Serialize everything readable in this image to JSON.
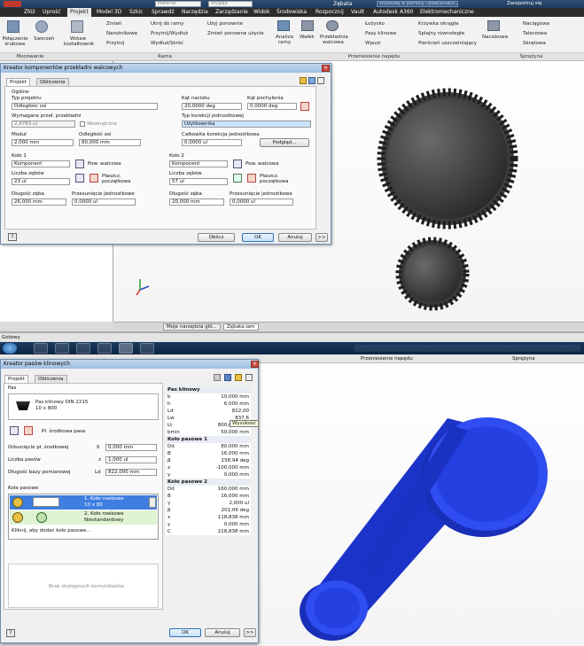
{
  "top": {
    "title_center": "Zębata",
    "title_search": "Wyszukaj w pomocy i poleceniach...",
    "title_signin": "Zarejestruj się",
    "title_material": "Materiał",
    "title_appearance": "Wygląd",
    "menu": [
      "Złóż",
      "Uprość",
      "Projekt",
      "Model 3D",
      "Szkic",
      "Sprawdź",
      "Narzędzia",
      "Zarządzanie",
      "Widok",
      "Środowiska",
      "Rozpocznij",
      "Vault",
      "Autodesk A360",
      "Elektromechaniczne"
    ],
    "ribbon": {
      "polaczenie": "Połączenie śrubowe",
      "sworzen": "Sworzeń",
      "wstaw": "Wstaw kształtownik",
      "zmien": "Zmień",
      "narozniki": "Narożnikowe",
      "przytnij": "Przytnij",
      "utnij": "Utnij do ramy",
      "przytnij_wydluz": "Przytnij/Wydłuż",
      "wydluz_skroc": "Wydłuż/Skróć",
      "uzyj_ponownie": "Użyj ponownie",
      "zmien_ponowne": "Zmień ponowne użycie",
      "analiza": "Analiza ramy",
      "walek": "Wałek",
      "przekladnia": "Przekładnia walcowa",
      "lozysko": "Łożysko",
      "pasy": "Pasy klinowe",
      "wpust": "Wpust",
      "krzywka": "Krzywka okrągła",
      "splajny": "Splajny równoległe",
      "pierscien": "Pierścień uszczelniający",
      "naciskowa": "Naciskowa",
      "naciagowa": "Naciągowa",
      "talerzowa": "Talerzowa",
      "skretowa": "Skrętowa",
      "grp_mocowanie": "Mocowanie",
      "grp_rama": "Rama",
      "grp_przeniesienie": "Przeniesienie napędu",
      "grp_sprezyna": "Sprężyna"
    },
    "dialog": {
      "title": "Kreator komponentów przekładni walcowych",
      "tab_projekt": "Projekt",
      "tab_obliczenia": "Obliczenia",
      "ogolne": "Ogólne",
      "typ_projektu": "Typ projektu",
      "typ_projektu_val": "Odległość osi",
      "wymagane": "Wymagane przeł. przekładni",
      "wymagane_val": "2,4783 ul",
      "wewnetrzne": "Wewnętrzne",
      "modul": "Moduł",
      "modul_val": "2,000 mm",
      "odl_osi": "Odległość osi",
      "odl_osi_val": "80,000 mm",
      "kat_nacisku": "Kąt nacisku",
      "kat_nacisku_val": "20,0000 deg",
      "kat_pochylenia": "Kąt pochylenia",
      "kat_pochylenia_val": "0,0000 deg",
      "typ_korekcji": "Typ korekcji jednostkowej",
      "typ_korekcji_val": "Użytkownika",
      "calkowita": "Całkowita korekcja jednostkowa",
      "calkowita_val": "0,0000 ul",
      "podglad": "Podgląd...",
      "kolo1": "Koło 1",
      "kolo2": "Koło 2",
      "komponent": "Komponent",
      "pow_walcowa": "Pow. walcowa",
      "liczba_zebow": "Liczba zębów",
      "z1": "23 ul",
      "z2": "57 ul",
      "plaszcz": "Płaszcz. początkowa",
      "dlugosc_zeba": "Długość zęba",
      "przesuniecie": "Przesunięcie jednostkowe",
      "b1": "26,000 mm",
      "b2": "20,000 mm",
      "x1": "0,0000 ul",
      "x2": "0,0000 ul",
      "oblicz": "Oblicz",
      "ok": "OK",
      "anuluj": "Anuluj",
      "more": ">>"
    },
    "browser_tabs": [
      "Moje narzędzia głó...",
      "Zębata.iam"
    ],
    "status": "Gotowy"
  },
  "bottom": {
    "ribbon_grp1": "Przeniesienie napędu",
    "ribbon_grp2": "Sprężyna",
    "dialog": {
      "title": "Kreator pasów klinowych",
      "tab_projekt": "Projekt",
      "tab_obliczenia": "Obliczenia",
      "pas": "Pas",
      "pas_name": "Pas klinowy DIN 2215",
      "pas_size": "10 x 800",
      "pl_srodkowa": "Pł. środkowa pasa",
      "odsuniecie": "Odsunięcie pł. środkowej",
      "odsuniecie_sym": "δ",
      "odsuniecie_val": "0,000 mm",
      "liczba_pasow": "Liczba pasów",
      "liczba_pasow_sym": "z",
      "liczba_pasow_val": "1,000 ul",
      "dlugosc_bazy": "Długość bazy pomiarowej",
      "dlugosc_bazy_sym": "Ld",
      "dlugosc_bazy_val": "822,000 mm",
      "kola": "Koła pasowe",
      "kolo1_a": "1. Koło rowkowe",
      "kolo1_b": "10 x 80",
      "kolo2_a": "2. Koło rowkowe",
      "kolo2_b": "Niestandardowy",
      "add": "Kliknij, aby dodać koło pasowe...",
      "brak": "Brak dostępnych komunikatów.",
      "ok": "OK",
      "anuluj": "Anuluj",
      "more": ">>",
      "tooltip": "Wysokość"
    },
    "props": {
      "pas_klinowy": "Pas klinowy",
      "kolo_pasowe_1": "Koło pasowe 1",
      "kolo_pasowe_2": "Koło pasowe 2",
      "rows1": [
        [
          "b",
          "10,000 mm"
        ],
        [
          "h",
          "6,000 mm"
        ],
        [
          "Ld",
          "822,00"
        ],
        [
          "Lw",
          "837,6"
        ],
        [
          "Lt",
          "800,000 mm"
        ],
        [
          "bmin",
          "50,000 mm"
        ]
      ],
      "rows2": [
        [
          "Dd",
          "80,000 mm"
        ],
        [
          "B",
          "16,000 mm"
        ],
        [
          "β",
          "158,94 deg"
        ],
        [
          "x",
          "-100,000 mm"
        ],
        [
          "y",
          "0,000 mm"
        ]
      ],
      "rows3": [
        [
          "Dd",
          "160,000 mm"
        ],
        [
          "B",
          "16,000 mm"
        ],
        [
          "γ",
          "2,000 ul"
        ],
        [
          "β",
          "201,06 deg"
        ],
        [
          "x",
          "118,838 mm"
        ],
        [
          "y",
          "0,000 mm"
        ],
        [
          "C",
          "218,838 mm"
        ]
      ]
    }
  }
}
